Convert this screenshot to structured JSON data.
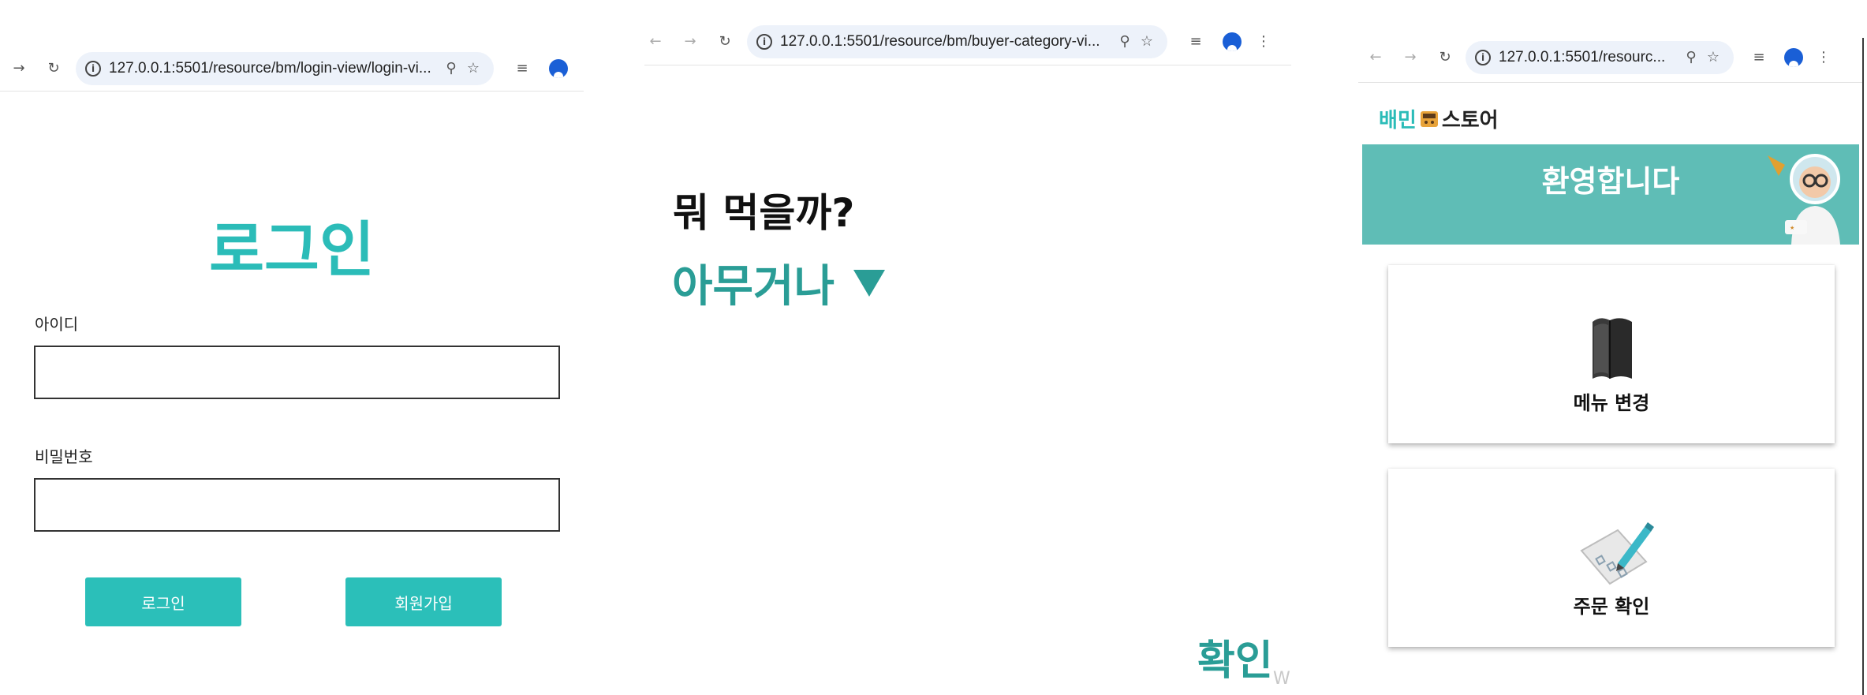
{
  "window1": {
    "url": "127.0.0.1:5501/resource/bm/login-view/login-vi...",
    "title": "로그인",
    "id_label": "아이디",
    "password_label": "비밀번호",
    "login_button": "로그인",
    "signup_button": "회원가입"
  },
  "window2": {
    "url": "127.0.0.1:5501/resource/bm/buyer-category-vi...",
    "question": "뭐 먹을까?",
    "selected_option": "아무거나",
    "confirm_label": "확인",
    "watermark": "W"
  },
  "window3": {
    "url": "127.0.0.1:5501/resourc...",
    "brand_part1": "배민",
    "brand_part2": "스토어",
    "banner_title": "환영합니다",
    "cards": [
      {
        "label": "메뉴 변경",
        "icon": "menu-book-icon"
      },
      {
        "label": "주문 확인",
        "icon": "order-checklist-icon"
      }
    ]
  },
  "colors": {
    "accent": "#2bbcb8",
    "accent_dark": "#2a9d96",
    "banner": "#5fbdb6"
  }
}
